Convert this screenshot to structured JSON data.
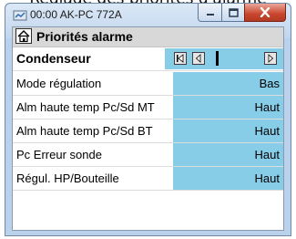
{
  "page": {
    "heading": "Réglage des priorités d'alarme"
  },
  "window": {
    "title": "00:00 AK-PC 772A",
    "icon": "device-icon",
    "controls": {
      "minimize": "minimize-icon",
      "maximize": "maximize-icon",
      "close": "close-icon"
    }
  },
  "header": {
    "title": "Priorités alarme",
    "home_icon": "home-icon"
  },
  "section": {
    "label": "Condenseur",
    "nav_icons": [
      "first-icon",
      "prev-icon",
      "next-icon"
    ]
  },
  "rows": [
    {
      "label": "Mode régulation",
      "value": "Bas"
    },
    {
      "label": "Alm haute temp Pc/Sd MT",
      "value": "Haut"
    },
    {
      "label": "Alm haute temp Pc/Sd BT",
      "value": "Haut"
    },
    {
      "label": "Pc Erreur sonde",
      "value": "Haut"
    },
    {
      "label": "Régul. HP/Bouteille",
      "value": "Haut"
    }
  ],
  "colors": {
    "value_bg": "#87cde8",
    "header_bg": "#d8d8d8",
    "close_red": "#c9452d"
  }
}
